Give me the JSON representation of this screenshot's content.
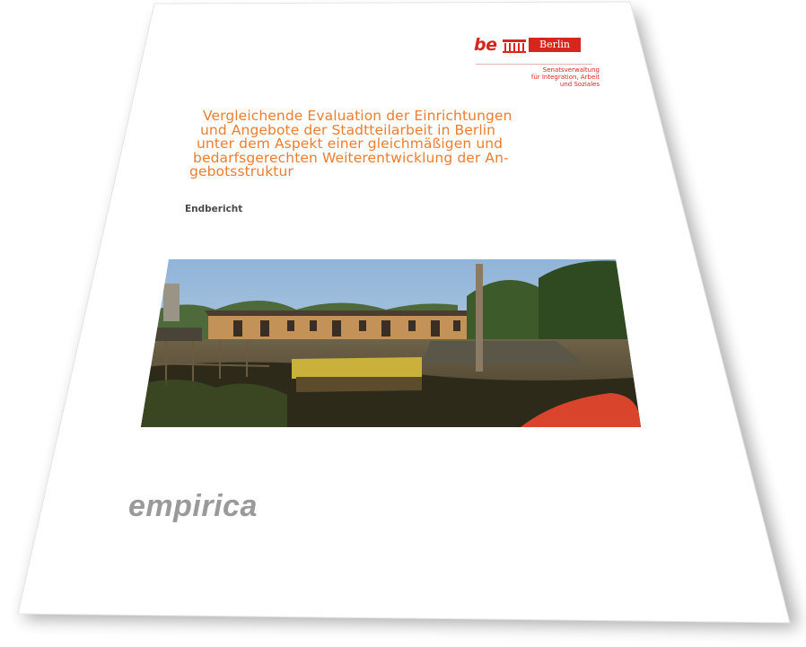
{
  "logo": {
    "be_text": "be",
    "city_text": "Berlin",
    "department_lines": [
      "Senatsverwaltung",
      "für Integration, Arbeit",
      "und Soziales"
    ]
  },
  "document": {
    "title_lines": [
      "Vergleichende Evaluation der Einrichtungen",
      "und Angebote der Stadtteilarbeit in Berlin",
      "unter dem Aspekt einer gleichmäßigen und",
      "bedarfsgerechten Weiterentwicklung der An-",
      "gebotsstruktur"
    ],
    "subtitle": "Endbericht",
    "publisher": "empirica"
  },
  "colors": {
    "title_orange": "#ee7d2f",
    "berlin_red": "#d7261e",
    "publisher_gray": "#9a9a9a"
  }
}
